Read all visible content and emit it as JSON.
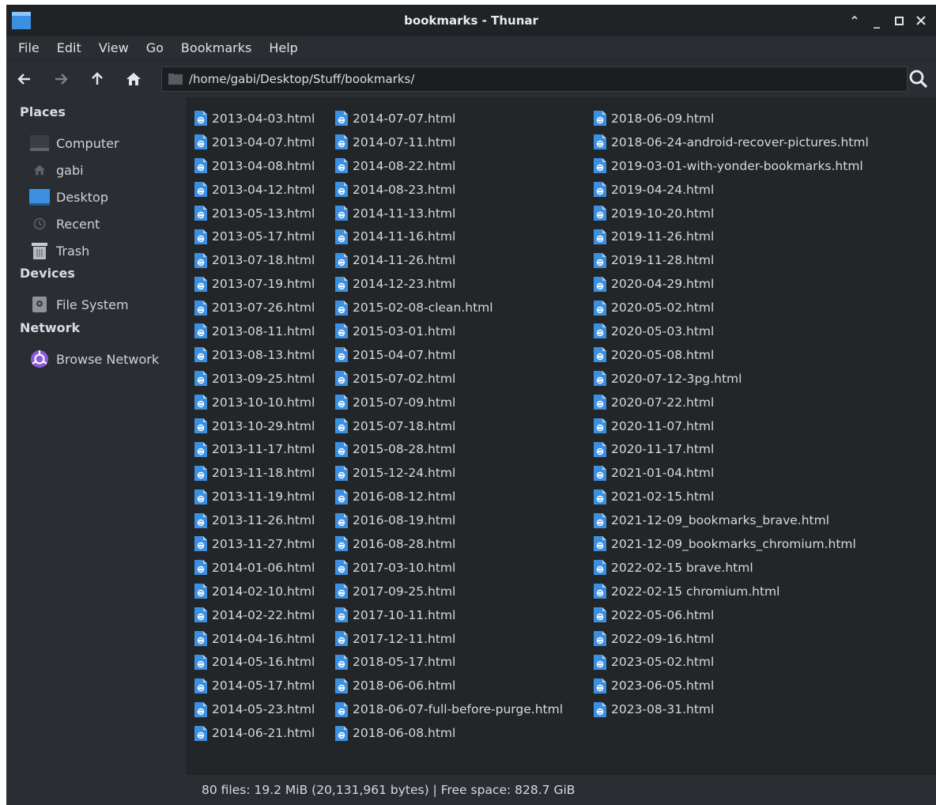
{
  "window": {
    "title": "bookmarks - Thunar"
  },
  "menubar": {
    "items": [
      "File",
      "Edit",
      "View",
      "Go",
      "Bookmarks",
      "Help"
    ]
  },
  "toolbar": {
    "location": "/home/gabi/Desktop/Stuff/bookmarks/"
  },
  "sidebar": {
    "places_heading": "Places",
    "places": [
      {
        "label": "Computer",
        "icon": "computer-icon"
      },
      {
        "label": "gabi",
        "icon": "home-icon"
      },
      {
        "label": "Desktop",
        "icon": "desktop-icon"
      },
      {
        "label": "Recent",
        "icon": "recent-icon"
      },
      {
        "label": "Trash",
        "icon": "trash-icon"
      }
    ],
    "devices_heading": "Devices",
    "devices": [
      {
        "label": "File System",
        "icon": "drive-icon"
      }
    ],
    "network_heading": "Network",
    "network": [
      {
        "label": "Browse Network",
        "icon": "network-icon"
      }
    ]
  },
  "files": {
    "columns": [
      [
        "2013-04-03.html",
        "2013-04-07.html",
        "2013-04-08.html",
        "2013-04-12.html",
        "2013-05-13.html",
        "2013-05-17.html",
        "2013-07-18.html",
        "2013-07-19.html",
        "2013-07-26.html",
        "2013-08-11.html",
        "2013-08-13.html",
        "2013-09-25.html",
        "2013-10-10.html",
        "2013-10-29.html",
        "2013-11-17.html",
        "2013-11-18.html",
        "2013-11-19.html",
        "2013-11-26.html",
        "2013-11-27.html",
        "2014-01-06.html",
        "2014-02-10.html",
        "2014-02-22.html",
        "2014-04-16.html",
        "2014-05-16.html",
        "2014-05-17.html",
        "2014-05-23.html",
        "2014-06-21.html"
      ],
      [
        "2014-07-07.html",
        "2014-07-11.html",
        "2014-08-22.html",
        "2014-08-23.html",
        "2014-11-13.html",
        "2014-11-16.html",
        "2014-11-26.html",
        "2014-12-23.html",
        "2015-02-08-clean.html",
        "2015-03-01.html",
        "2015-04-07.html",
        "2015-07-02.html",
        "2015-07-09.html",
        "2015-07-18.html",
        "2015-08-28.html",
        "2015-12-24.html",
        "2016-08-12.html",
        "2016-08-19.html",
        "2016-08-28.html",
        "2017-03-10.html",
        "2017-09-25.html",
        "2017-10-11.html",
        "2017-12-11.html",
        "2018-05-17.html",
        "2018-06-06.html",
        "2018-06-07-full-before-purge.html",
        "2018-06-08.html"
      ],
      [
        "2018-06-09.html",
        "2018-06-24-android-recover-pictures.html",
        "2019-03-01-with-yonder-bookmarks.html",
        "2019-04-24.html",
        "2019-10-20.html",
        "2019-11-26.html",
        "2019-11-28.html",
        "2020-04-29.html",
        "2020-05-02.html",
        "2020-05-03.html",
        "2020-05-08.html",
        "2020-07-12-3pg.html",
        "2020-07-22.html",
        "2020-11-07.html",
        "2020-11-17.html",
        "2021-01-04.html",
        "2021-02-15.html",
        "2021-12-09_bookmarks_brave.html",
        "2021-12-09_bookmarks_chromium.html",
        "2022-02-15 brave.html",
        "2022-02-15 chromium.html",
        "2022-05-06.html",
        "2022-09-16.html",
        "2023-05-02.html",
        "2023-06-05.html",
        "2023-08-31.html"
      ]
    ]
  },
  "statusbar": {
    "text": "80 files: 19.2 MiB (20,131,961 bytes)  |  Free space: 828.7 GiB"
  }
}
